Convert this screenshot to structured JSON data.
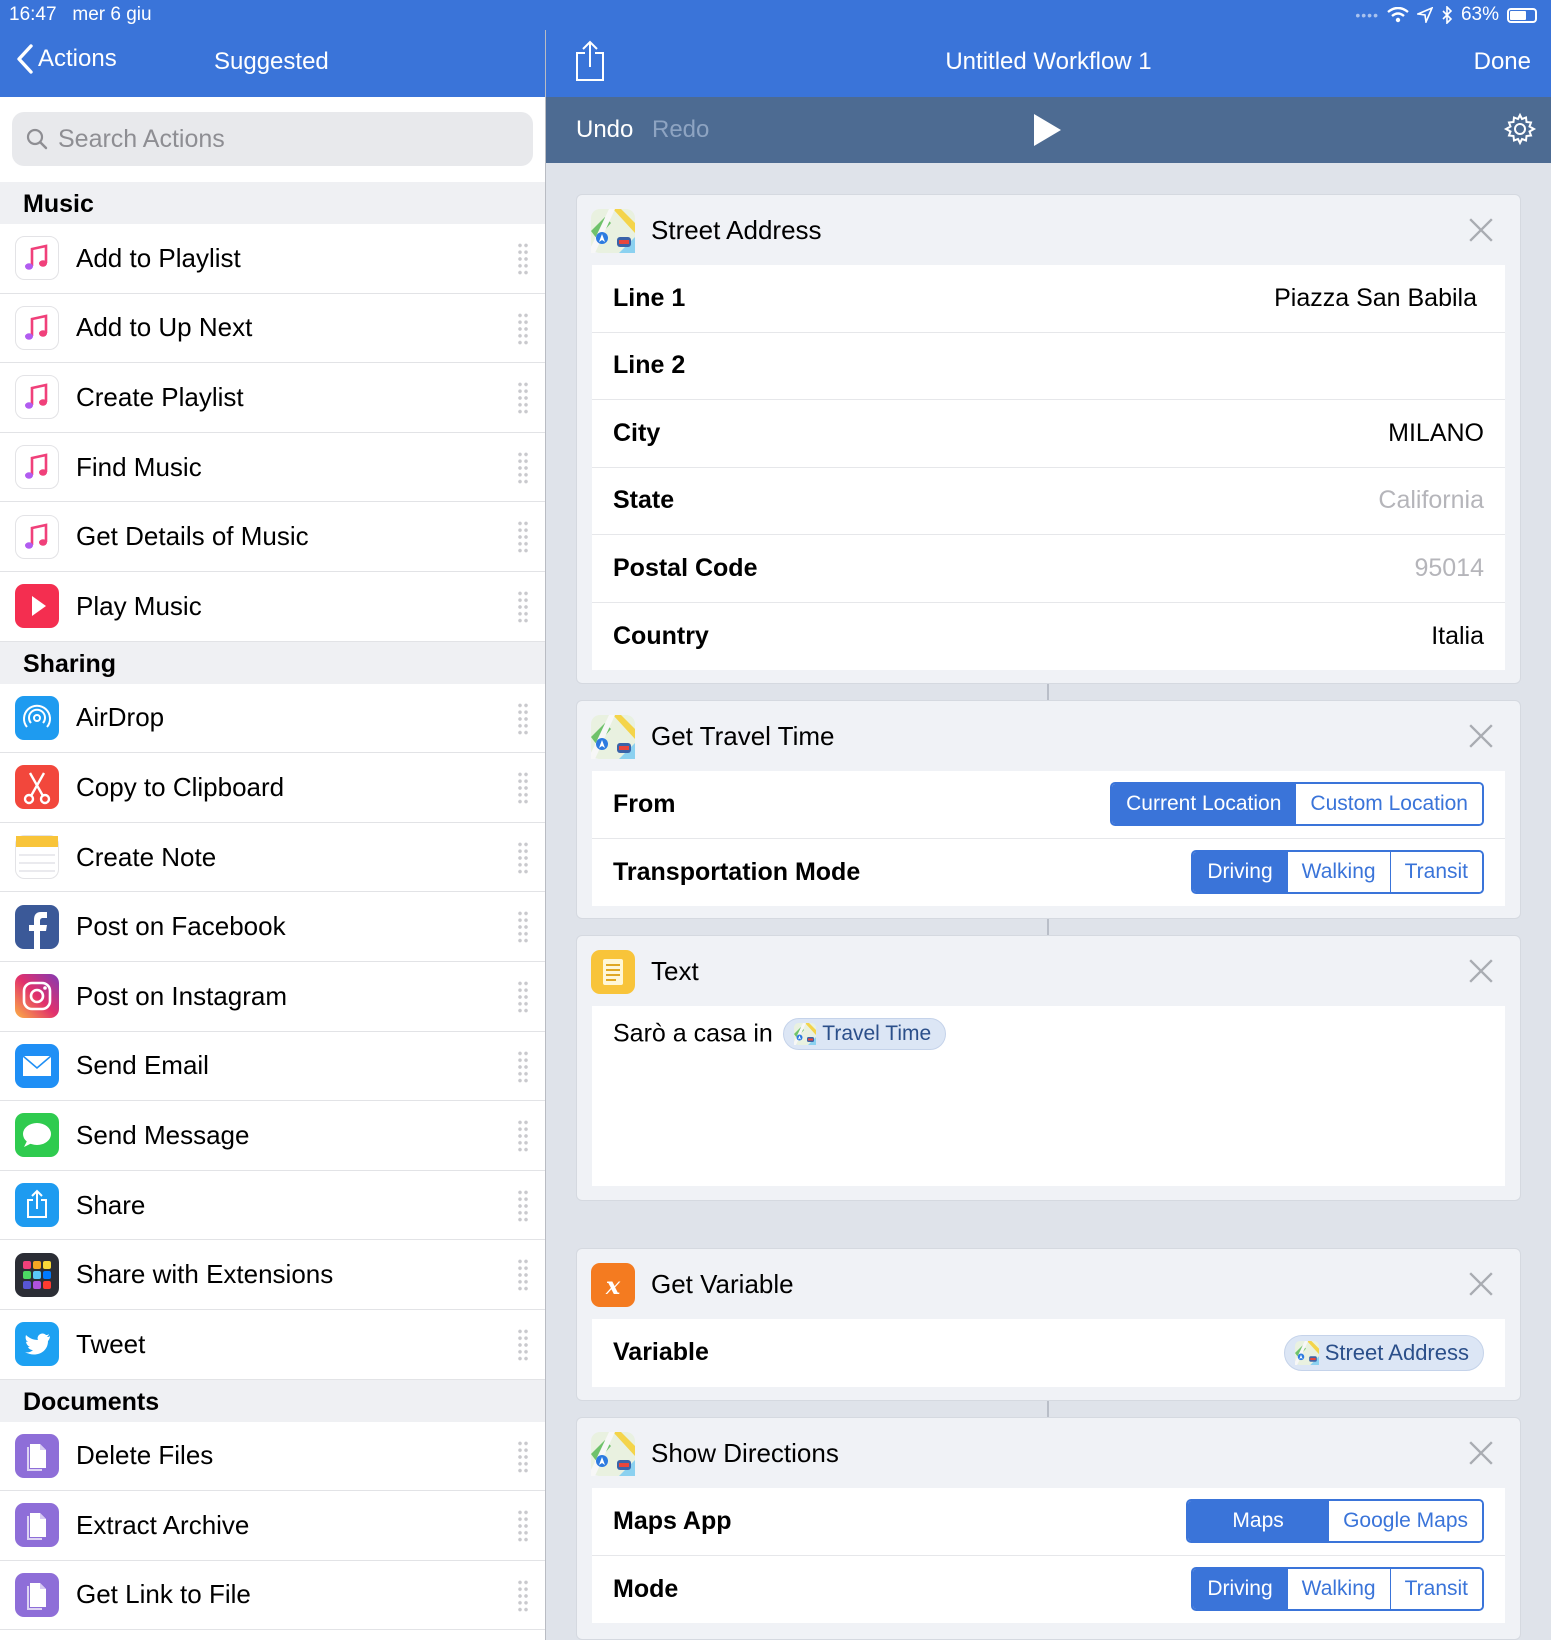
{
  "status": {
    "time": "16:47",
    "date": "mer 6 giu",
    "battery": "63%"
  },
  "left_nav": {
    "back": "Actions",
    "title": "Suggested"
  },
  "search": {
    "placeholder": "Search Actions",
    "value": ""
  },
  "sections": [
    {
      "title": "Music",
      "items": [
        {
          "label": "Add to Playlist",
          "icon": "music-note-icon"
        },
        {
          "label": "Add to Up Next",
          "icon": "music-note-icon"
        },
        {
          "label": "Create Playlist",
          "icon": "music-note-icon"
        },
        {
          "label": "Find Music",
          "icon": "music-note-icon"
        },
        {
          "label": "Get Details of Music",
          "icon": "music-note-icon"
        },
        {
          "label": "Play Music",
          "icon": "play-icon"
        }
      ]
    },
    {
      "title": "Sharing",
      "items": [
        {
          "label": "AirDrop",
          "icon": "airdrop-icon"
        },
        {
          "label": "Copy to Clipboard",
          "icon": "scissors-icon"
        },
        {
          "label": "Create Note",
          "icon": "notes-icon"
        },
        {
          "label": "Post on Facebook",
          "icon": "facebook-icon"
        },
        {
          "label": "Post on Instagram",
          "icon": "instagram-icon"
        },
        {
          "label": "Send Email",
          "icon": "mail-icon"
        },
        {
          "label": "Send Message",
          "icon": "message-icon"
        },
        {
          "label": "Share",
          "icon": "share-icon"
        },
        {
          "label": "Share with Extensions",
          "icon": "extensions-icon"
        },
        {
          "label": "Tweet",
          "icon": "twitter-icon"
        }
      ]
    },
    {
      "title": "Documents",
      "items": [
        {
          "label": "Delete Files",
          "icon": "file-icon"
        },
        {
          "label": "Extract Archive",
          "icon": "file-icon"
        },
        {
          "label": "Get Link to File",
          "icon": "file-icon"
        }
      ]
    }
  ],
  "right_nav": {
    "title": "Untitled Workflow 1",
    "done": "Done"
  },
  "toolbar": {
    "undo": "Undo",
    "redo": "Redo"
  },
  "cards": {
    "street": {
      "title": "Street Address",
      "fields": [
        {
          "label": "Line 1",
          "value": "Piazza San Babila",
          "placeholder": false
        },
        {
          "label": "Line 2",
          "value": "",
          "placeholder": false
        },
        {
          "label": "City",
          "value": "MILANO",
          "placeholder": false
        },
        {
          "label": "State",
          "value": "California",
          "placeholder": true
        },
        {
          "label": "Postal Code",
          "value": "95014",
          "placeholder": true
        },
        {
          "label": "Country",
          "value": "Italia",
          "placeholder": false
        }
      ]
    },
    "travel": {
      "title": "Get Travel Time",
      "from_label": "From",
      "from_options": [
        "Current Location",
        "Custom Location"
      ],
      "from_selected": "Current Location",
      "mode_label": "Transportation Mode",
      "mode_options": [
        "Driving",
        "Walking",
        "Transit"
      ],
      "mode_selected": "Driving"
    },
    "text": {
      "title": "Text",
      "content": "Sarò a casa in",
      "token": "Travel Time"
    },
    "variable": {
      "title": "Get Variable",
      "label": "Variable",
      "token": "Street Address"
    },
    "directions": {
      "title": "Show Directions",
      "app_label": "Maps App",
      "app_options": [
        "Maps",
        "Google Maps"
      ],
      "app_selected": "Maps",
      "mode_label": "Mode",
      "mode_options": [
        "Driving",
        "Walking",
        "Transit"
      ],
      "mode_selected": "Driving"
    }
  }
}
